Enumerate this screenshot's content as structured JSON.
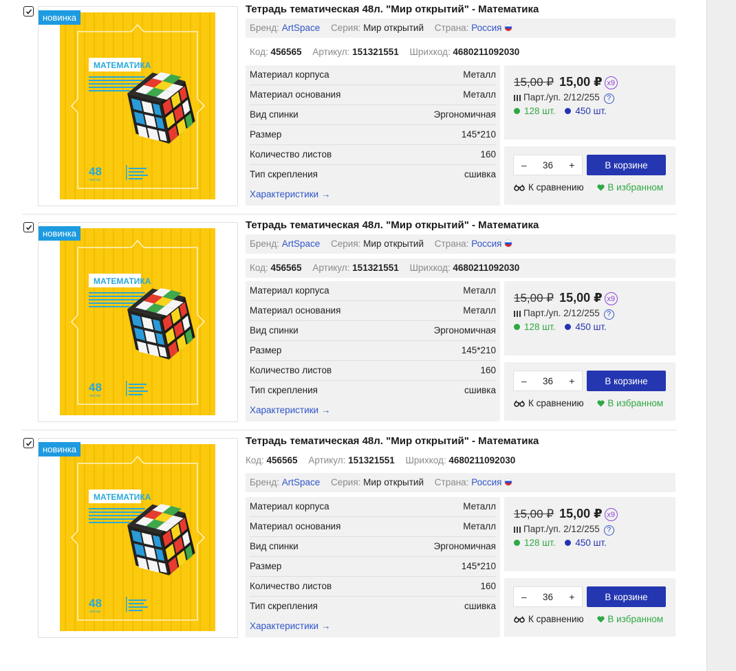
{
  "products": [
    {
      "badge": "новинка",
      "title": "Тетрадь тематическая 48л. \"Мир открытий\" - Математика",
      "brand_label": "Бренд:",
      "brand": "ArtSpace",
      "series_label": "Серия:",
      "series": "Мир открытий",
      "country_label": "Страна:",
      "country": "Россия",
      "code_label": "Код:",
      "code": "456565",
      "article_label": "Артикул:",
      "article": "151321551",
      "barcode_label": "Шрихкод:",
      "barcode": "4680211092030",
      "specs": [
        {
          "name": "Материал корпуса",
          "value": "Металл"
        },
        {
          "name": "Материал основания",
          "value": "Металл"
        },
        {
          "name": "Вид спинки",
          "value": "Эргономичная"
        },
        {
          "name": "Размер",
          "value": "145*210"
        },
        {
          "name": "Количество листов",
          "value": "160"
        },
        {
          "name": "Тип скрепления",
          "value": "сшивка"
        }
      ],
      "specs_link": "Характеристики →",
      "old_price": "15,00 ₽",
      "new_price": "15,00 ₽",
      "multiplier": "x9",
      "pack": "Парт./уп. 2/12/255",
      "pack_help": "?",
      "stock_green": "128 шт.",
      "stock_blue": "450 шт.",
      "qty_minus": "–",
      "qty": "36",
      "qty_plus": "+",
      "cart_label": "В корзине",
      "compare_label": "К сравнению",
      "favorite_label": "В избранном"
    },
    {
      "badge": "новинка",
      "title": "Тетрадь тематическая 48л. \"Мир открытий\" - Математика",
      "brand_label": "Бренд:",
      "brand": "ArtSpace",
      "series_label": "Серия:",
      "series": "Мир открытий",
      "country_label": "Страна:",
      "country": "Россия",
      "code_label": "Код:",
      "code": "456565",
      "article_label": "Артикул:",
      "article": "151321551",
      "barcode_label": "Шрихкод:",
      "barcode": "4680211092030",
      "specs": [
        {
          "name": "Материал корпуса",
          "value": "Металл"
        },
        {
          "name": "Материал основания",
          "value": "Металл"
        },
        {
          "name": "Вид спинки",
          "value": "Эргономичная"
        },
        {
          "name": "Размер",
          "value": "145*210"
        },
        {
          "name": "Количество листов",
          "value": "160"
        },
        {
          "name": "Тип скрепления",
          "value": "сшивка"
        }
      ],
      "specs_link": "Характеристики →",
      "old_price": "15,00 ₽",
      "new_price": "15,00 ₽",
      "multiplier": "x9",
      "pack": "Парт./уп. 2/12/255",
      "pack_help": "?",
      "stock_green": "128 шт.",
      "stock_blue": "450 шт.",
      "qty_minus": "–",
      "qty": "36",
      "qty_plus": "+",
      "cart_label": "В корзине",
      "compare_label": "К сравнению",
      "favorite_label": "В избранном"
    },
    {
      "badge": "новинка",
      "title": "Тетрадь тематическая 48л. \"Мир открытий\" - Математика",
      "brand_label": "Бренд:",
      "brand": "ArtSpace",
      "series_label": "Серия:",
      "series": "Мир открытий",
      "country_label": "Страна:",
      "country": "Россия",
      "code_label": "Код:",
      "code": "456565",
      "article_label": "Артикул:",
      "article": "151321551",
      "barcode_label": "Шрихкод:",
      "barcode": "4680211092030",
      "specs": [
        {
          "name": "Материал корпуса",
          "value": "Металл"
        },
        {
          "name": "Материал основания",
          "value": "Металл"
        },
        {
          "name": "Вид спинки",
          "value": "Эргономичная"
        },
        {
          "name": "Размер",
          "value": "145*210"
        },
        {
          "name": "Количество листов",
          "value": "160"
        },
        {
          "name": "Тип скрепления",
          "value": "сшивка"
        }
      ],
      "specs_link": "Характеристики →",
      "old_price": "15,00 ₽",
      "new_price": "15,00 ₽",
      "multiplier": "x9",
      "pack": "Парт./уп. 2/12/255",
      "pack_help": "?",
      "stock_green": "128 шт.",
      "stock_blue": "450 шт.",
      "qty_minus": "–",
      "qty": "36",
      "qty_plus": "+",
      "cart_label": "В корзине",
      "compare_label": "К сравнению",
      "favorite_label": "В избранном"
    }
  ],
  "cover": {
    "title": "МАТЕМАТИКА",
    "number": "48",
    "unit": "листов"
  },
  "colors": {
    "accent_blue": "#2436b0",
    "link_blue": "#2f55c9",
    "badge_blue": "#1e9be0",
    "stock_green": "#2ea843",
    "multiplier_purple": "#8b45d6",
    "cover_yellow": "#f9c80e"
  }
}
